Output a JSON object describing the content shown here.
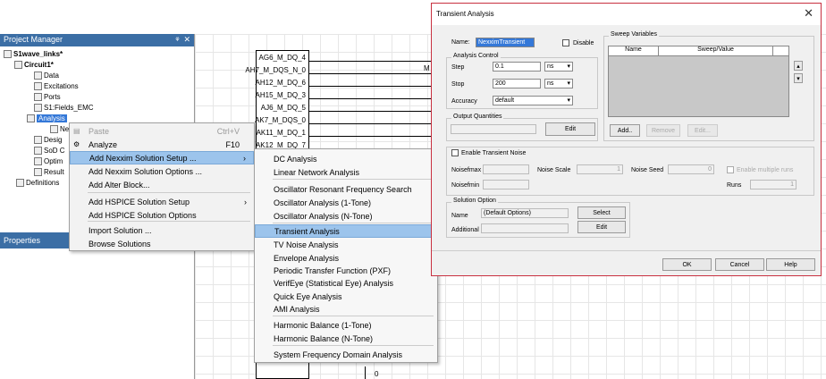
{
  "project_manager": {
    "title": "Project Manager",
    "pin": "ᵠ",
    "close": "✕",
    "tree": [
      "S1wave_links*",
      "Circuit1*",
      "Data",
      "Excitations",
      "Ports",
      "S1:Fields_EMC",
      "Analysis",
      "Ne",
      "Desig",
      "SoD C",
      "Optim",
      "Result",
      "Definitions"
    ]
  },
  "properties": {
    "title": "Properties"
  },
  "canvas": {
    "signals": [
      "AG6_M_DQ_4",
      "AH7_M_DQS_N_0",
      "AH12_M_DQ_6",
      "AH15_M_DQ_3",
      "AJ6_M_DQ_5",
      "AK7_M_DQS_0",
      "AK11_M_DQ_1",
      "AK12_M_DQ_7"
    ],
    "side_label": "M",
    "bottom_label": "0"
  },
  "context_menu": {
    "items": [
      {
        "label": "Paste",
        "shortcut": "Ctrl+V",
        "disabled": true
      },
      {
        "label": "Analyze",
        "shortcut": "F10"
      },
      {
        "label": "Add Nexxim Solution Setup ...",
        "arrow": "›"
      },
      {
        "label": "Add Nexxim Solution Options ..."
      },
      {
        "label": "Add Alter Block..."
      },
      {
        "label": "Add HSPICE Solution Setup",
        "arrow": "›"
      },
      {
        "label": "Add HSPICE Solution Options"
      },
      {
        "label": "Import Solution ..."
      },
      {
        "label": "Browse Solutions"
      }
    ]
  },
  "submenu": {
    "items": [
      "DC Analysis",
      "Linear Network Analysis",
      "Oscillator Resonant Frequency Search",
      "Oscillator Analysis (1-Tone)",
      "Oscillator Analysis (N-Tone)",
      "Transient Analysis",
      "TV Noise Analysis",
      "Envelope Analysis",
      "Periodic Transfer Function (PXF)",
      "VerifEye (Statistical Eye) Analysis",
      "Quick Eye Analysis",
      "AMI Analysis",
      "Harmonic Balance (1-Tone)",
      "Harmonic Balance (N-Tone)",
      "System Frequency Domain Analysis"
    ]
  },
  "dialog": {
    "title": "Transient Analysis",
    "close": "✕",
    "name_label": "Name:",
    "name_value": "NexximTransient",
    "disable_label": "Disable",
    "analysis_control": {
      "title": "Analysis Control",
      "step_label": "Step",
      "step_value": "0.1",
      "step_unit": "ns",
      "stop_label": "Stop",
      "stop_value": "200",
      "stop_unit": "ns",
      "accuracy_label": "Accuracy",
      "accuracy_value": "default"
    },
    "output": {
      "title": "Output Quantities",
      "edit": "Edit"
    },
    "sweep": {
      "title": "Sweep Variables",
      "col_name": "Name",
      "col_value": "Sweep/Value",
      "add": "Add..",
      "remove": "Remove",
      "edit": "Edit..."
    },
    "noise": {
      "enable_label": "Enable Transient Noise",
      "noisefmax": "Noisefmax",
      "noise_scale": "Noise Scale",
      "noise_scale_value": "1",
      "noise_seed": "Noise Seed",
      "noise_seed_value": "0",
      "enable_multiple": "Enable multiple runs",
      "noisefmin": "Noisefmin",
      "runs": "Runs",
      "runs_value": "1"
    },
    "solution": {
      "title": "Solution Option",
      "name_label": "Name",
      "name_value": "(Default Options)",
      "select": "Select",
      "additional_label": "Additional",
      "edit": "Edit"
    },
    "ok": "OK",
    "cancel": "Cancel",
    "help": "Help"
  }
}
